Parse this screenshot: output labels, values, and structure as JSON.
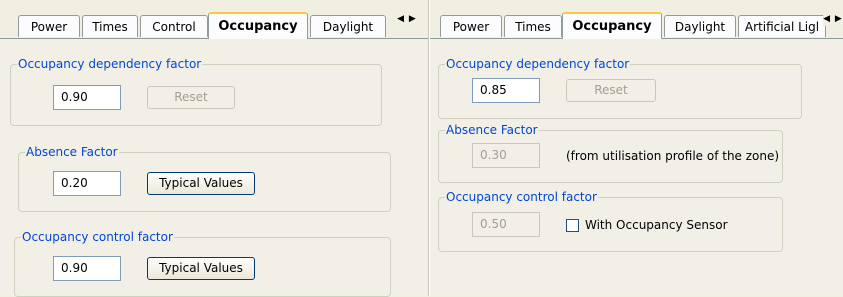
{
  "left": {
    "tabs": [
      "Power",
      "Times",
      "Control",
      "Occupancy",
      "Daylight"
    ],
    "occupancy_dependency": {
      "legend": "Occupancy dependency factor",
      "value": "0.90",
      "reset_label": "Reset"
    },
    "absence": {
      "legend": "Absence Factor",
      "value": "0.20",
      "button_label": "Typical Values"
    },
    "control": {
      "legend": "Occupancy control factor",
      "value": "0.90",
      "button_label": "Typical Values"
    }
  },
  "right": {
    "tabs": [
      "Power",
      "Times",
      "Occupancy",
      "Daylight",
      "Artificial Ligl"
    ],
    "occupancy_dependency": {
      "legend": "Occupancy dependency factor",
      "value": "0.85",
      "reset_label": "Reset"
    },
    "absence": {
      "legend": "Absence Factor",
      "value": "0.30",
      "note": "(from utilisation profile of the zone)"
    },
    "control": {
      "legend": "Occupancy control factor",
      "value": "0.50",
      "checkbox_label": "With Occupancy Sensor",
      "checkbox_checked": false
    }
  },
  "tab_scroll_glyph": "◀ ▶",
  "accent_color": "#0046d5"
}
